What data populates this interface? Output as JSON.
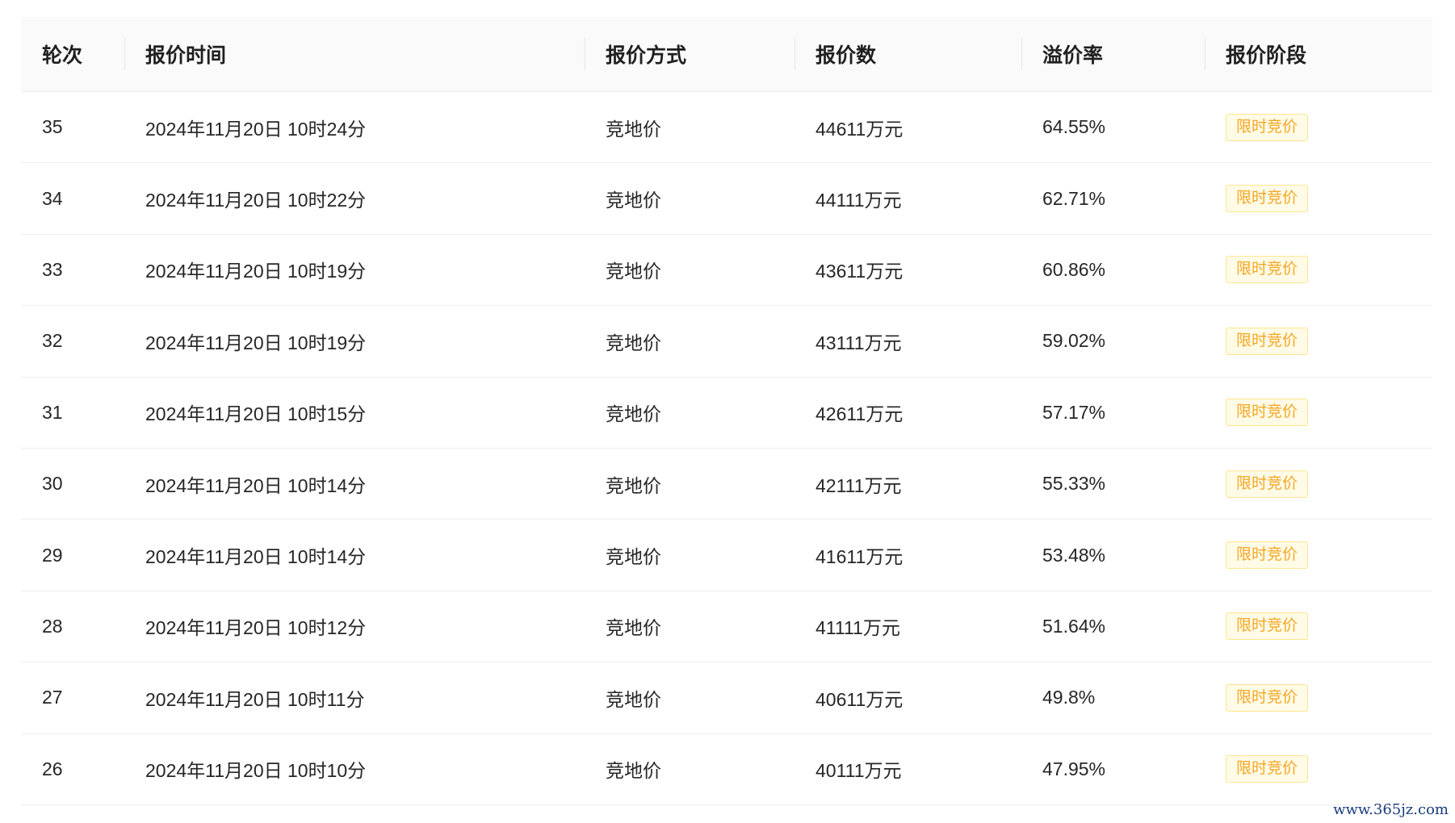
{
  "table": {
    "columns": [
      "轮次",
      "报价时间",
      "报价方式",
      "报价数",
      "溢价率",
      "报价阶段"
    ],
    "rows": [
      {
        "round": "35",
        "time": "2024年11月20日 10时24分",
        "method": "竞地价",
        "amount": "44611万元",
        "premium": "64.55%",
        "stage": "限时竞价"
      },
      {
        "round": "34",
        "time": "2024年11月20日 10时22分",
        "method": "竞地价",
        "amount": "44111万元",
        "premium": "62.71%",
        "stage": "限时竞价"
      },
      {
        "round": "33",
        "time": "2024年11月20日 10时19分",
        "method": "竞地价",
        "amount": "43611万元",
        "premium": "60.86%",
        "stage": "限时竞价"
      },
      {
        "round": "32",
        "time": "2024年11月20日 10时19分",
        "method": "竞地价",
        "amount": "43111万元",
        "premium": "59.02%",
        "stage": "限时竞价"
      },
      {
        "round": "31",
        "time": "2024年11月20日 10时15分",
        "method": "竞地价",
        "amount": "42611万元",
        "premium": "57.17%",
        "stage": "限时竞价"
      },
      {
        "round": "30",
        "time": "2024年11月20日 10时14分",
        "method": "竞地价",
        "amount": "42111万元",
        "premium": "55.33%",
        "stage": "限时竞价"
      },
      {
        "round": "29",
        "time": "2024年11月20日 10时14分",
        "method": "竞地价",
        "amount": "41611万元",
        "premium": "53.48%",
        "stage": "限时竞价"
      },
      {
        "round": "28",
        "time": "2024年11月20日 10时12分",
        "method": "竞地价",
        "amount": "41111万元",
        "premium": "51.64%",
        "stage": "限时竞价"
      },
      {
        "round": "27",
        "time": "2024年11月20日 10时11分",
        "method": "竞地价",
        "amount": "40611万元",
        "premium": "49.8%",
        "stage": "限时竞价"
      },
      {
        "round": "26",
        "time": "2024年11月20日 10时10分",
        "method": "竞地价",
        "amount": "40111万元",
        "premium": "47.95%",
        "stage": "限时竞价"
      }
    ]
  },
  "watermark": "www.365jz.com",
  "colors": {
    "header_bg": "#fafafa",
    "tag_text": "#f5a623",
    "tag_bg": "#fffbe6",
    "tag_border": "#ffe58f"
  }
}
